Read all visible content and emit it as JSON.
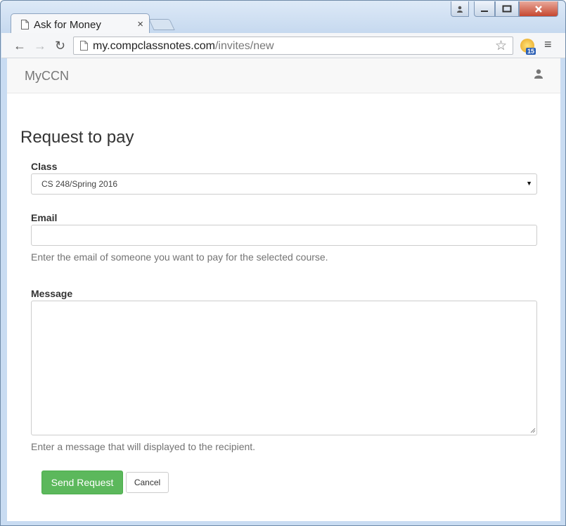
{
  "browser": {
    "tab_title": "Ask for Money",
    "tab_close": "×",
    "url_host": "my.compclassnotes.com",
    "url_path": "/invites/new",
    "extension_badge": "15"
  },
  "navbar": {
    "brand": "MyCCN"
  },
  "form": {
    "title": "Request to pay",
    "class_label": "Class",
    "class_selected": "CS 248/Spring 2016",
    "email_label": "Email",
    "email_value": "",
    "email_help": "Enter the email of someone you want to pay for the selected course.",
    "message_label": "Message",
    "message_value": "",
    "message_help": "Enter a message that will displayed to the recipient.",
    "send_button": "Send Request",
    "cancel_button": "Cancel"
  },
  "colors": {
    "primary_success": "#5cb85c",
    "navbar_bg": "#f8f8f8"
  }
}
